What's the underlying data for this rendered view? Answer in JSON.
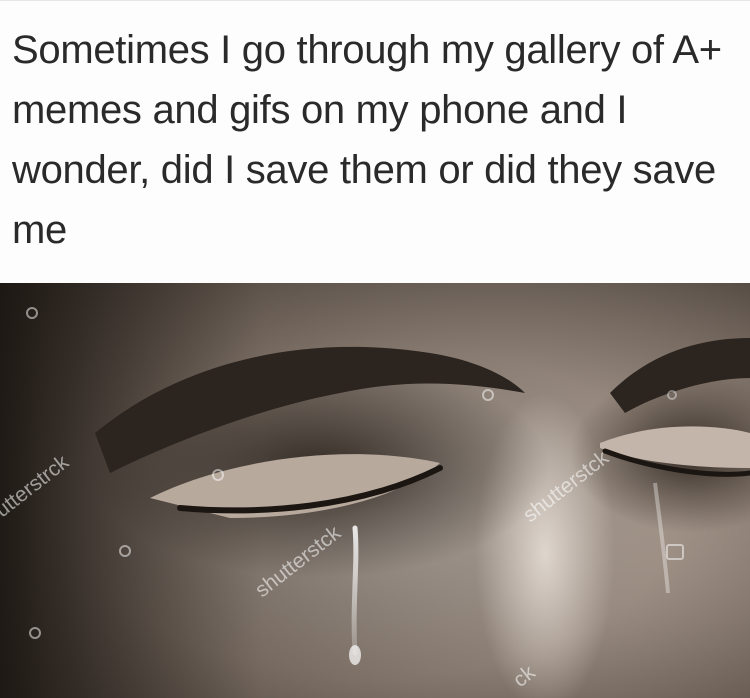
{
  "caption": {
    "text": "Sometimes I go through my gallery of A+ memes and gifs on my phone and I wonder, did I save them or did they save me"
  },
  "photo": {
    "subject": "close-up of a crying face with closed eyes",
    "watermarks": [
      "utterstr⁠ck",
      "shutterst⁠ck",
      "shutterst⁠ck",
      "shutterst⁠ck",
      "ck"
    ],
    "colors": {
      "skin_light": "#d9d0c8",
      "skin_mid": "#a9978a",
      "skin_dark": "#4a3f38",
      "shadow": "#1e1915"
    }
  }
}
